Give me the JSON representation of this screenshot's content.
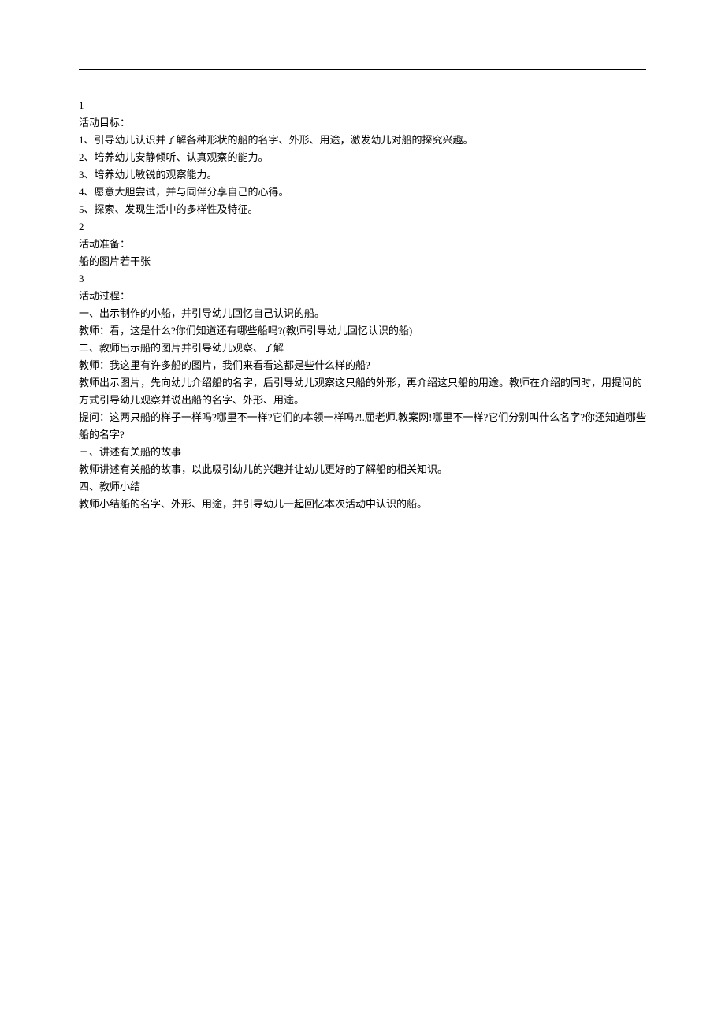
{
  "section1": {
    "number": "1",
    "title": "活动目标：",
    "items": [
      "1、引导幼儿认识并了解各种形状的船的名字、外形、用途，激发幼儿对船的探究兴趣。",
      "2、培养幼儿安静倾听、认真观察的能力。",
      "3、培养幼儿敏锐的观察能力。",
      "4、愿意大胆尝试，并与同伴分享自己的心得。",
      "5、探索、发现生活中的多样性及特征。"
    ]
  },
  "section2": {
    "number": "2",
    "title": "活动准备：",
    "content": "船的图片若干张"
  },
  "section3": {
    "number": "3",
    "title": "活动过程：",
    "lines": [
      "一、出示制作的小船，并引导幼儿回忆自己认识的船。",
      "教师：看，这是什么?你们知道还有哪些船吗?(教师引导幼儿回忆认识的船)",
      "二、教师出示船的图片并引导幼儿观察、了解",
      "教师：我这里有许多船的图片，我们来看看这都是些什么样的船?",
      "教师出示图片，先向幼儿介绍船的名字，后引导幼儿观察这只船的外形，再介绍这只船的用途。教师在介绍的同时，用提问的方式引导幼儿观察并说出船的名字、外形、用途。",
      "提问：这两只船的样子一样吗?哪里不一样?它们的本领一样吗?!.屈老师.教案网!哪里不一样?它们分别叫什么名字?你还知道哪些船的名字?",
      "三、讲述有关船的故事",
      "教师讲述有关船的故事，以此吸引幼儿的兴趣并让幼儿更好的了解船的相关知识。",
      "四、教师小结",
      "教师小结船的名字、外形、用途，并引导幼儿一起回忆本次活动中认识的船。"
    ]
  }
}
